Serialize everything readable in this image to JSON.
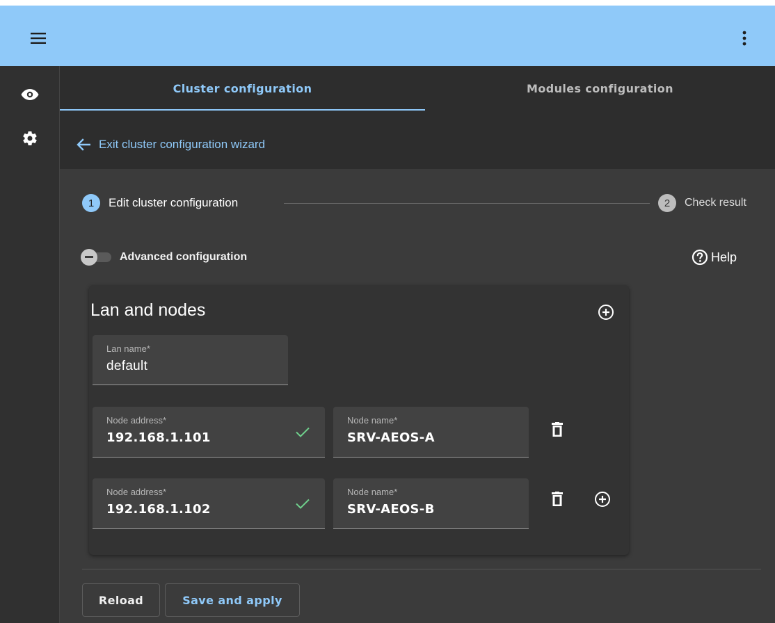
{
  "header": {
    "menu_icon": "menu-icon",
    "more_icon": "more-vert-icon"
  },
  "sidebar": {
    "items": [
      {
        "icon": "eye-icon"
      },
      {
        "icon": "gear-icon"
      }
    ]
  },
  "tabs": [
    {
      "label": "Cluster configuration",
      "active": true
    },
    {
      "label": "Modules configuration",
      "active": false
    }
  ],
  "exit_link": {
    "label": "Exit cluster configuration wizard",
    "icon": "arrow-left-icon"
  },
  "stepper": {
    "steps": [
      {
        "number": "1",
        "label": "Edit cluster configuration",
        "active": true
      },
      {
        "number": "2",
        "label": "Check result",
        "active": false
      }
    ]
  },
  "advanced": {
    "label": "Advanced configuration",
    "enabled": false
  },
  "help": {
    "label": "Help",
    "icon": "help-circle-icon"
  },
  "lan_card": {
    "title": "Lan and nodes",
    "lan_name": {
      "label": "Lan name*",
      "value": "default"
    },
    "nodes": [
      {
        "address_label": "Node address*",
        "address": "192.168.1.101",
        "name_label": "Node name*",
        "name": "SRV-AEOS-A",
        "valid": true
      },
      {
        "address_label": "Node address*",
        "address": "192.168.1.102",
        "name_label": "Node name*",
        "name": "SRV-AEOS-B",
        "valid": true
      }
    ]
  },
  "footer": {
    "reload_label": "Reload",
    "save_label": "Save and apply"
  },
  "colors": {
    "topbar": "#8fc9f9",
    "accent": "#8fc9f9",
    "background": "#3b3b3b",
    "card": "#333333",
    "field": "#424242",
    "check": "#6fd08c"
  }
}
